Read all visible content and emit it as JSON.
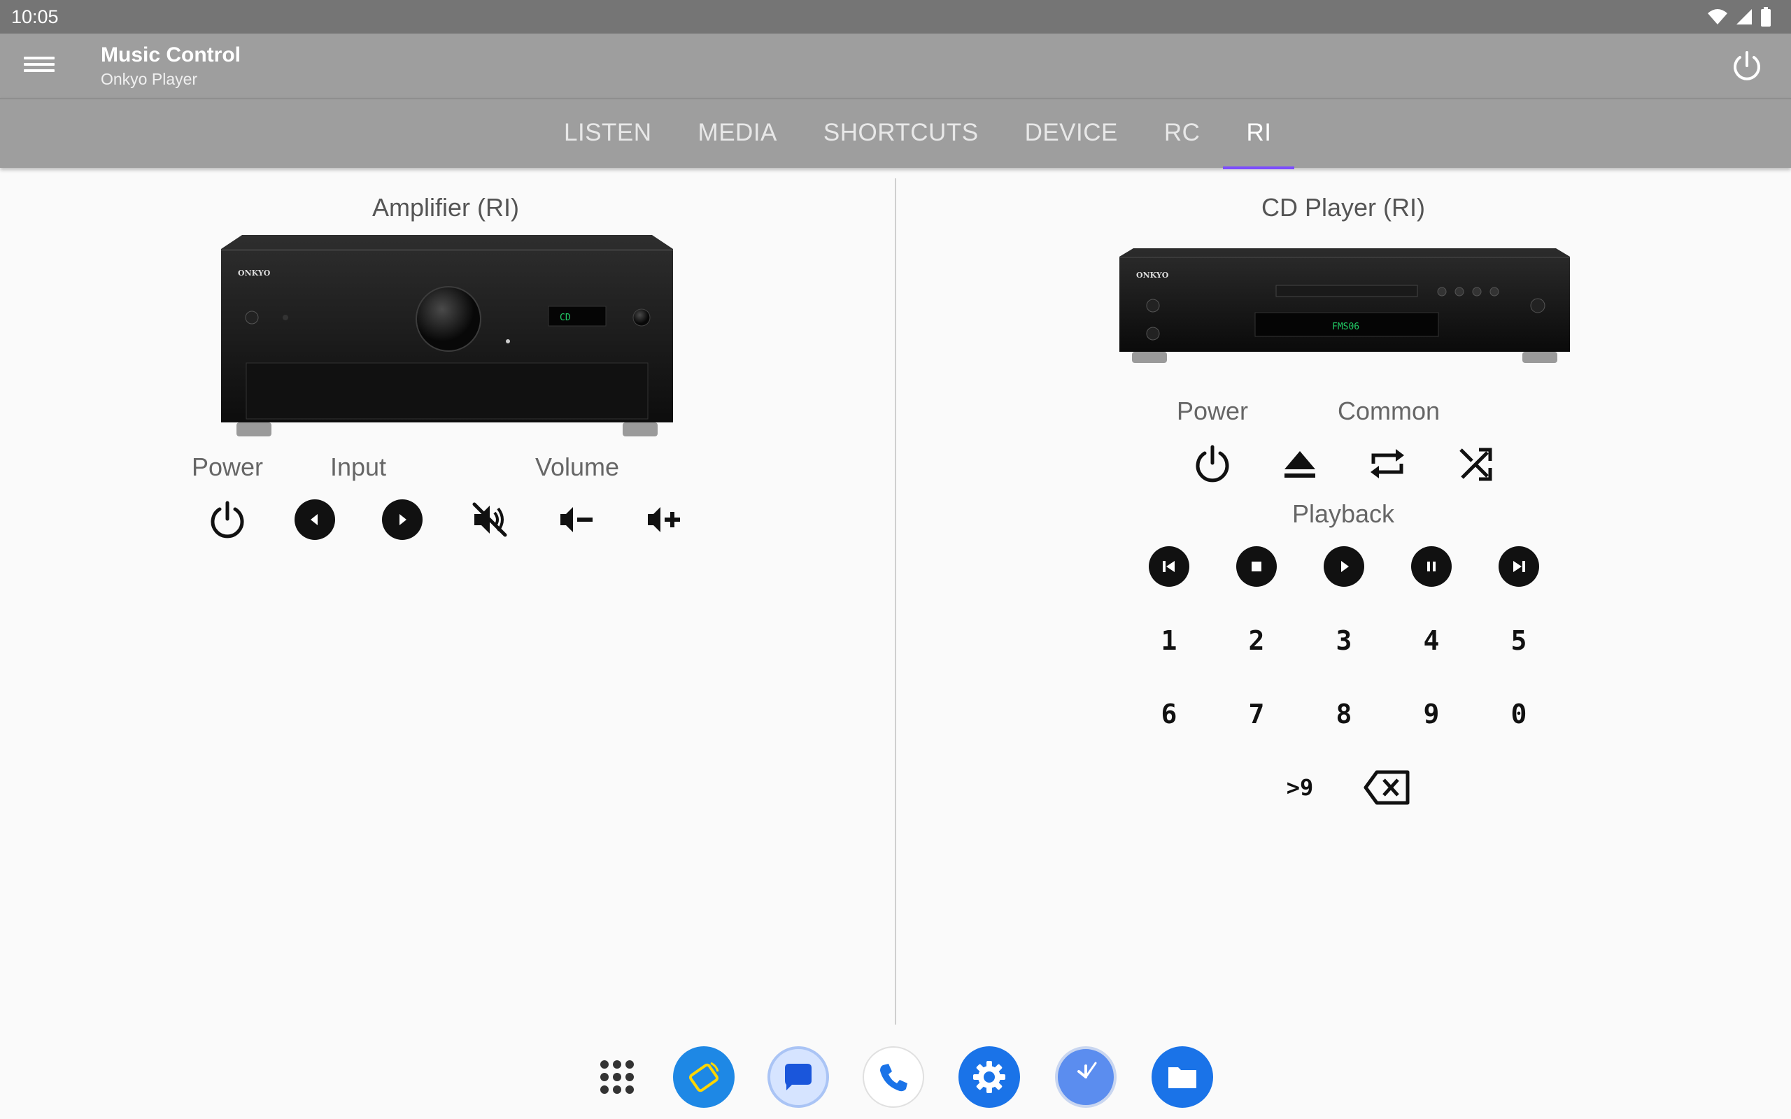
{
  "status": {
    "time": "10:05"
  },
  "app": {
    "title": "Music Control",
    "subtitle": "Onkyo Player"
  },
  "tabs": [
    {
      "label": "LISTEN"
    },
    {
      "label": "MEDIA"
    },
    {
      "label": "SHORTCUTS"
    },
    {
      "label": "DEVICE"
    },
    {
      "label": "RC"
    },
    {
      "label": "RI"
    }
  ],
  "active_tab": "RI",
  "amplifier": {
    "title": "Amplifier (RI)",
    "brand": "ONKYO",
    "display": "CD",
    "groups": {
      "power": "Power",
      "input": "Input",
      "volume": "Volume"
    }
  },
  "cd_player": {
    "title": "CD Player (RI)",
    "brand": "ONKYO",
    "display": "FMS06",
    "groups": {
      "power": "Power",
      "common": "Common",
      "playback": "Playback"
    },
    "digits_row1": [
      "1",
      "2",
      "3",
      "4",
      "5"
    ],
    "digits_row2": [
      "6",
      "7",
      "8",
      "9",
      "0"
    ],
    "more_label": ">9"
  },
  "colors": {
    "tab_indicator": "#7c4dff",
    "bar": "#9e9e9e",
    "status_bar": "#757575"
  }
}
